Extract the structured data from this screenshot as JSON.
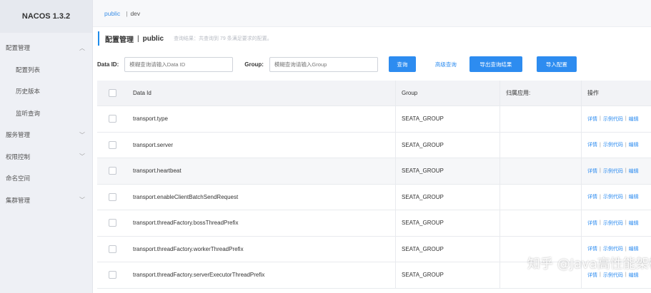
{
  "sidebar": {
    "brand": "NACOS 1.3.2",
    "items": [
      {
        "label": "配置管理",
        "chevron": "^"
      },
      {
        "label": "配置列表"
      },
      {
        "label": "历史版本"
      },
      {
        "label": "监听查询"
      },
      {
        "label": "服务管理",
        "chevron": "v"
      },
      {
        "label": "权限控制",
        "chevron": "v"
      },
      {
        "label": "命名空间"
      },
      {
        "label": "集群管理",
        "chevron": "v"
      }
    ]
  },
  "breadcrumb": {
    "namespace": "public",
    "separator": "|",
    "env": "dev"
  },
  "header": {
    "title": "配置管理",
    "separator": "|",
    "namespace": "public",
    "query_info": "查询结果：共查询到 79 条满足要求的配置。"
  },
  "filters": {
    "data_id_label": "Data ID:",
    "data_id_placeholder": "模糊查询请输入Data ID",
    "group_label": "Group:",
    "group_placeholder": "模糊查询请输入Group",
    "query_button": "查询",
    "advanced_button": "高级查询",
    "export_button": "导出查询结果",
    "import_button": "导入配置"
  },
  "table": {
    "headers": {
      "data_id": "Data Id",
      "group": "Group",
      "app": "归属应用:",
      "ops": "操作"
    },
    "rows": [
      {
        "data_id": "transport.type",
        "group": "SEATA_GROUP",
        "app": ""
      },
      {
        "data_id": "transport.server",
        "group": "SEATA_GROUP",
        "app": ""
      },
      {
        "data_id": "transport.heartbeat",
        "group": "SEATA_GROUP",
        "app": ""
      },
      {
        "data_id": "transport.enableClientBatchSendRequest",
        "group": "SEATA_GROUP",
        "app": ""
      },
      {
        "data_id": "transport.threadFactory.bossThreadPrefix",
        "group": "SEATA_GROUP",
        "app": ""
      },
      {
        "data_id": "transport.threadFactory.workerThreadPrefix",
        "group": "SEATA_GROUP",
        "app": ""
      },
      {
        "data_id": "transport.threadFactory.serverExecutorThreadPrefix",
        "group": "SEATA_GROUP",
        "app": ""
      }
    ],
    "ops": {
      "detail": "详情",
      "sample": "示例代码",
      "edit": "编辑",
      "sep": "|"
    }
  },
  "watermark": "知乎 @Java高性能架构"
}
